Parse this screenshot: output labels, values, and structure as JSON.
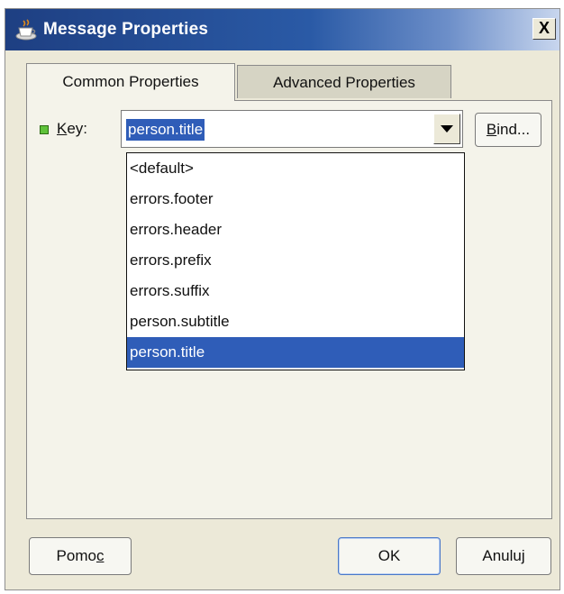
{
  "window": {
    "title": "Message Properties",
    "close_label": "X"
  },
  "tabs": [
    {
      "label": "Common Properties",
      "active": true
    },
    {
      "label": "Advanced Properties",
      "active": false
    }
  ],
  "key_field": {
    "label_mnemonic": "K",
    "label_rest": "ey:",
    "value": "person.title",
    "bind_mnemonic": "B",
    "bind_rest": "ind..."
  },
  "dropdown": {
    "items": [
      "<default>",
      "errors.footer",
      "errors.header",
      "errors.prefix",
      "errors.suffix",
      "person.subtitle",
      "person.title"
    ],
    "selected": "person.title"
  },
  "buttons": {
    "help_prefix": "Pomo",
    "help_mnemonic": "c",
    "ok": "OK",
    "cancel": "Anuluj"
  },
  "colors": {
    "selection": "#2f5db8",
    "indicator": "#5fc23a"
  }
}
